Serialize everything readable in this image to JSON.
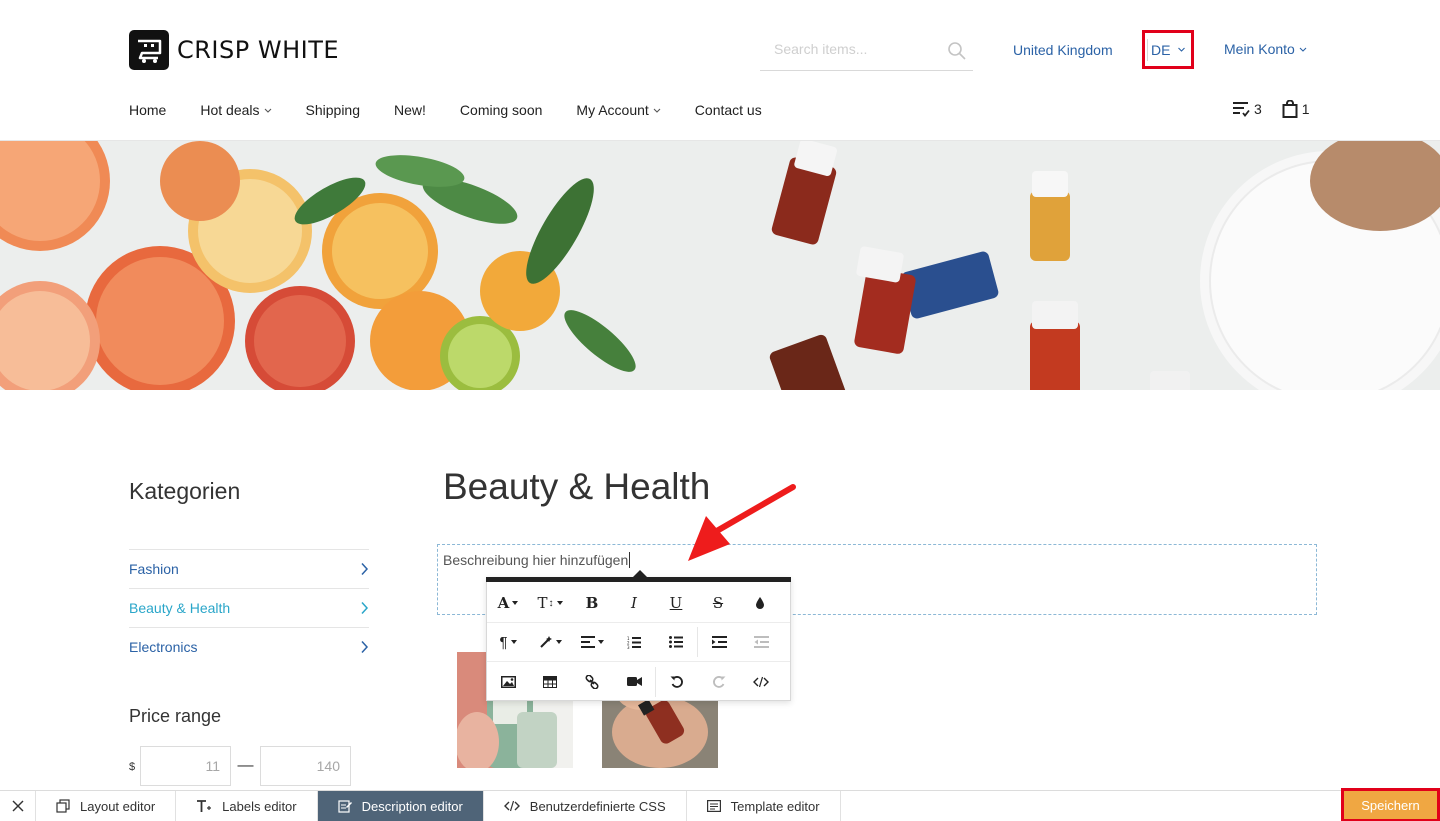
{
  "brand": {
    "name": "CRISP WHITE"
  },
  "header": {
    "search_placeholder": "Search items...",
    "country": "United Kingdom",
    "language": "DE",
    "account": "Mein Konto"
  },
  "nav": {
    "items": [
      {
        "label": "Home",
        "dropdown": false
      },
      {
        "label": "Hot deals",
        "dropdown": true
      },
      {
        "label": "Shipping",
        "dropdown": false
      },
      {
        "label": "New!",
        "dropdown": false
      },
      {
        "label": "Coming soon",
        "dropdown": false
      },
      {
        "label": "My Account",
        "dropdown": true
      },
      {
        "label": "Contact us",
        "dropdown": false
      }
    ],
    "wishlist_count": "3",
    "cart_count": "1"
  },
  "sidebar": {
    "title": "Kategorien",
    "categories": [
      {
        "label": "Fashion",
        "active": false
      },
      {
        "label": "Beauty & Health",
        "active": true
      },
      {
        "label": "Electronics",
        "active": false
      }
    ],
    "price_title": "Price range",
    "currency": "$",
    "price_min": "11",
    "price_max": "140"
  },
  "main": {
    "title": "Beauty & Health",
    "description_placeholder": "Beschreibung hier hinzufügen"
  },
  "editor_toolbar": {
    "row1": [
      "font-family-icon",
      "font-size-icon",
      "bold-icon",
      "italic-icon",
      "underline-icon",
      "strikethrough-icon",
      "color-drop-icon"
    ],
    "row2": [
      "paragraph-icon",
      "style-wand-icon",
      "align-icon",
      "ordered-list-icon",
      "unordered-list-icon",
      "indent-icon",
      "outdent-icon"
    ],
    "row3": [
      "image-icon",
      "table-icon",
      "link-icon",
      "video-icon",
      "undo-icon",
      "redo-icon",
      "code-view-icon"
    ],
    "labels": {
      "bold": "B",
      "italic": "I",
      "underline": "U",
      "strike": "S",
      "font": "A",
      "size": "T",
      "paragraph": "¶"
    }
  },
  "editor_bar": {
    "tabs": [
      {
        "label": "Layout editor",
        "active": false
      },
      {
        "label": "Labels editor",
        "active": false
      },
      {
        "label": "Description editor",
        "active": true
      },
      {
        "label": "Benutzerdefinierte CSS",
        "active": false
      },
      {
        "label": "Template editor",
        "active": false
      }
    ],
    "save_label": "Speichern"
  },
  "colors": {
    "link": "#2b62a6",
    "active_category": "#2aa6c9",
    "highlight_box": "#e1001a",
    "save_button": "#f0a742",
    "active_tab": "#4f6478"
  }
}
